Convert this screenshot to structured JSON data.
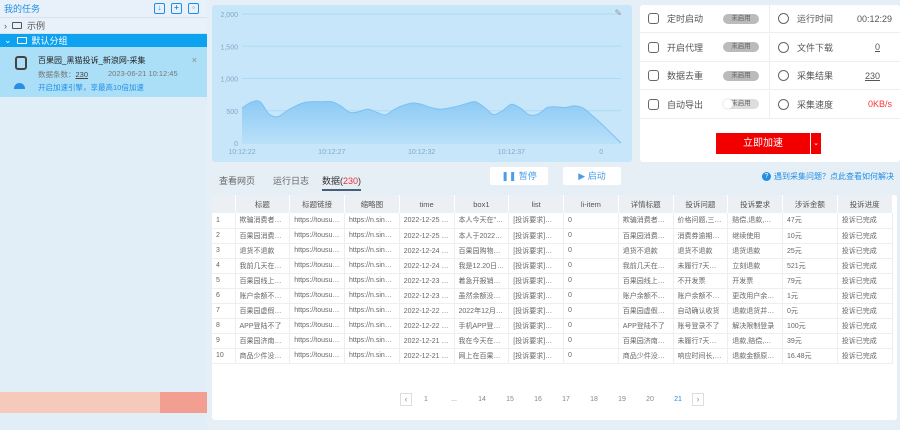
{
  "sidebar": {
    "title": "我的任务",
    "folders": [
      {
        "label": "示例",
        "expanded": false
      },
      {
        "label": "默认分组",
        "expanded": true
      }
    ],
    "task": {
      "name": "百果园_黑猫投诉_新浪网-采集",
      "count_label": "数据条数：",
      "count": "230",
      "date": "2023-06-21 10:12:45",
      "accelerate": "开启加速引擎，享最高10倍加速"
    }
  },
  "chart_data": {
    "type": "area",
    "title": "",
    "xlabel": "",
    "ylabel": "",
    "ylim": [
      0,
      2000
    ],
    "yticks": [
      "0",
      "500",
      "1,000",
      "1,500",
      "2,000"
    ],
    "xticks": [
      "10:12:22",
      "10:12:27",
      "10:12:32",
      "10:12:37",
      "0"
    ],
    "x": [
      0,
      0.5,
      1,
      1.5,
      2,
      2.5,
      3,
      3.5,
      4,
      4.5,
      5,
      5.5,
      6,
      6.5,
      7,
      7.5,
      8,
      8.5,
      9,
      9.5,
      10,
      10.5,
      11,
      11.5,
      12,
      12.5,
      13,
      13.5,
      14,
      14.5,
      15,
      15.5,
      16,
      16.5,
      17,
      17.5,
      18,
      18.5,
      19,
      19.5,
      20,
      21.1
    ],
    "values": [
      540,
      630,
      640,
      450,
      410,
      500,
      575,
      630,
      640,
      640,
      640,
      575,
      475,
      485,
      525,
      475,
      435,
      525,
      585,
      620,
      600,
      550,
      525,
      540,
      570,
      610,
      640,
      550,
      440,
      500,
      600,
      540,
      435,
      450,
      550,
      560,
      550,
      575,
      540,
      425,
      300,
      0
    ]
  },
  "stats": {
    "rows": [
      {
        "left": {
          "icon": "alarm-clock-icon",
          "label": "定时启动",
          "state": "未启用"
        },
        "right": {
          "icon": "clock-icon",
          "label": "运行时间",
          "value": "00:12:29"
        }
      },
      {
        "left": {
          "icon": "globe-icon",
          "label": "开启代理",
          "state": "未启用"
        },
        "right": {
          "icon": "file-download-icon",
          "label": "文件下载",
          "value": "0"
        }
      },
      {
        "left": {
          "icon": "dedupe-icon",
          "label": "数据去重",
          "state": "未启用"
        },
        "right": {
          "icon": "bar-chart-icon",
          "label": "采集结果",
          "value": "230"
        }
      },
      {
        "left": {
          "icon": "export-icon",
          "label": "自动导出",
          "state": "未启用"
        },
        "right": {
          "icon": "speedometer-icon",
          "label": "采集速度",
          "value": "0KB/s"
        }
      }
    ],
    "boost_label": "立即加速"
  },
  "tabs": {
    "items": [
      "查看网页",
      "运行日志",
      "数据"
    ],
    "data_count": "230",
    "pause": "暂停",
    "start": "启动",
    "help": "遇到采集问题？点此查看如何解决"
  },
  "table": {
    "headers": [
      "",
      "标题",
      "标题链接",
      "缩略图",
      "time",
      "box1",
      "list",
      "li-item",
      "详情标题",
      "投诉问题",
      "投诉要求",
      "涉诉金额",
      "投诉进度"
    ],
    "rows": [
      [
        "1",
        "欺骗消费者，...",
        "https://tousu.s...",
        "https://n.sinaim...",
        "2022-12-25 于...",
        "本人今天在\"饿...",
        "[投诉要求]赔偿...",
        "0",
        "欺骗消费者，...",
        "价格问题,三包...",
        "赔偿,退款,作出...",
        "47元",
        "投诉已完成"
      ],
      [
        "2",
        "百果园消费券...",
        "https://tousu.s...",
        "https://n.sinaim...",
        "2022-12-25 于...",
        "本人于2022年...",
        "[投诉要求]继续...",
        "0",
        "百果园消费券...",
        "消费券逾期不...",
        "继续使用",
        "10元",
        "投诉已完成"
      ],
      [
        "3",
        "退货不退款",
        "https://tousu.s...",
        "https://n.sinaim...",
        "2022-12-24 于...",
        "百果园购物，...",
        "[投诉要求]退货...",
        "0",
        "退货不退款",
        "退货不退款",
        "退货退款",
        "25元",
        "投诉已完成"
      ],
      [
        "4",
        "我前几天在百...",
        "https://tousu.s...",
        "https://n.sinaim...",
        "2022-12-24 于...",
        "我是12.20日在...",
        "[投诉要求]立刻...",
        "0",
        "我前几天在百...",
        "未履行7天无理...",
        "立刻退款",
        "521元",
        "投诉已完成"
      ],
      [
        "5",
        "百果园线上订...",
        "https://tousu.s...",
        "https://n.sinaim...",
        "2022-12-23 于...",
        "着急开报销，...",
        "[投诉要求]开发...",
        "0",
        "百果园线上订...",
        "不开发票",
        "开发票",
        "79元",
        "投诉已完成"
      ],
      [
        "6",
        "账户余额不超...",
        "https://tousu.s...",
        "https://n.sinaim...",
        "2022-12-23 于...",
        "虽然余额没有...",
        "[投诉要求]更改...",
        "0",
        "账户余额不超...",
        "账户余额不能...",
        "更改用户余额...",
        "1元",
        "投诉已完成"
      ],
      [
        "7",
        "百果园虚假发...",
        "https://tousu.s...",
        "https://n.sinaim...",
        "2022-12-22 于...",
        "2022年12月21...",
        "[投诉要求]退款...",
        "0",
        "百果园虚假发...",
        "自动确认收货",
        "退款退货并赔偿",
        "0元",
        "投诉已完成"
      ],
      [
        "8",
        "APP登陆不了",
        "https://tousu.s...",
        "https://n.sinaim...",
        "2022-12-22 于...",
        "手机APP登陆...",
        "[投诉要求]解决...",
        "0",
        "APP登陆不了",
        "账号登录不了",
        "解决限制登录",
        "100元",
        "投诉已完成"
      ],
      [
        "9",
        "百果园济南华...",
        "https://tousu.s...",
        "https://n.sinaim...",
        "2022-12-21 于...",
        "我在今天在百...",
        "[投诉要求]退款...",
        "0",
        "百果园济南华...",
        "未履行7天无理...",
        "退款,赔偿,退款...",
        "39元",
        "投诉已完成"
      ],
      [
        "10",
        "商品少件没提...",
        "https://tousu.s...",
        "https://n.sinaim...",
        "2022-12-21 于...",
        "网上在百果园...",
        "[投诉要求]退款...",
        "0",
        "商品少件没提...",
        "响应时间长,无...",
        "退款金额原路...",
        "16.48元",
        "投诉已完成"
      ]
    ]
  },
  "pager": {
    "pages": [
      "1",
      "...",
      "14",
      "15",
      "16",
      "17",
      "18",
      "19",
      "20",
      "21"
    ],
    "current": "21"
  },
  "colors": {
    "accent": "#1f8ee6",
    "boost": "#f20000",
    "selected": "#0da2f0"
  }
}
